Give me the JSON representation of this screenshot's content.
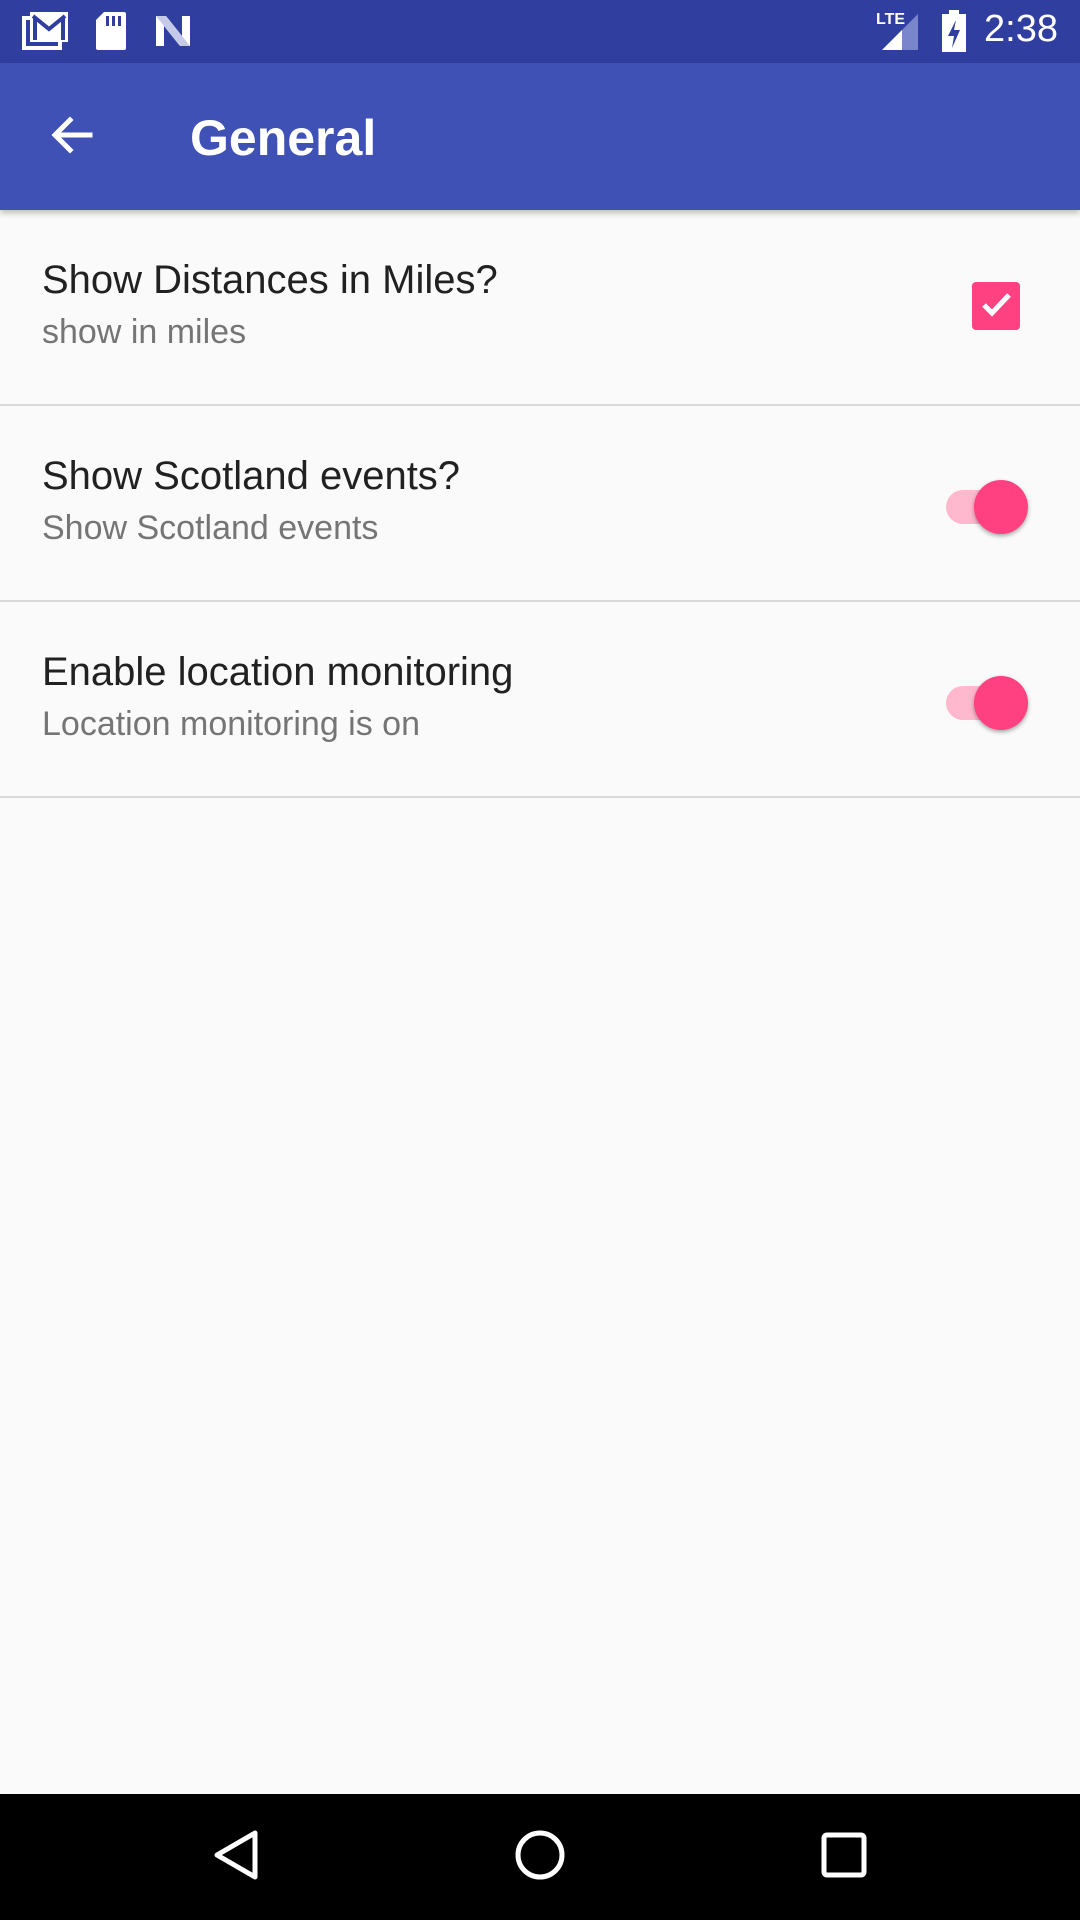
{
  "status_bar": {
    "time": "2:38",
    "left_icons": [
      "gmail-icon",
      "sd-card-icon",
      "n-app-icon"
    ],
    "right_icons": [
      "lte-signal-icon",
      "battery-charging-icon"
    ],
    "background": "#303F9F"
  },
  "app_bar": {
    "title": "General",
    "back_icon": "arrow-back-icon",
    "background": "#3F51B5"
  },
  "preferences": [
    {
      "title": "Show Distances in Miles?",
      "summary": "show in miles",
      "control": "checkbox",
      "checked": true
    },
    {
      "title": "Show Scotland events?",
      "summary": "Show Scotland events",
      "control": "switch",
      "checked": true
    },
    {
      "title": "Enable location monitoring",
      "summary": "Location monitoring is on",
      "control": "switch",
      "checked": true
    }
  ],
  "colors": {
    "accent": "#FF4081",
    "accent_track": "#FFB8CE",
    "primary": "#3F51B5",
    "primary_dark": "#303F9F"
  },
  "nav_bar": {
    "icons": [
      "back-triangle-icon",
      "home-circle-icon",
      "recents-square-icon"
    ]
  }
}
